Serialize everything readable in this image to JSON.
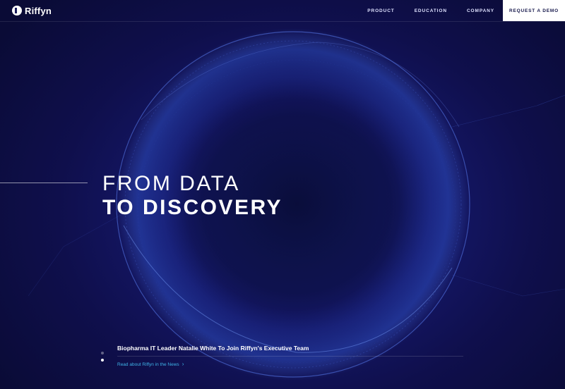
{
  "header": {
    "logo_text": "Riffyn",
    "nav": [
      {
        "label": "PRODUCT"
      },
      {
        "label": "EDUCATION"
      },
      {
        "label": "COMPANY"
      }
    ],
    "cta_label": "REQUEST A DEMO"
  },
  "hero": {
    "headline_line1": "FROM DATA",
    "headline_line2": "TO DISCOVERY"
  },
  "news": {
    "title": "Biopharma IT Leader Natalie White To Join Riffyn's Executive Team",
    "link_label": "Read about Riffyn in the News",
    "link_icon": "chevron-right-icon",
    "carousel_slides": 2,
    "active_slide": 2
  },
  "colors": {
    "background": "#0d0f3c",
    "accent_link": "#3fb4e8",
    "cta_background": "#ffffff",
    "cta_text": "#15174a"
  }
}
